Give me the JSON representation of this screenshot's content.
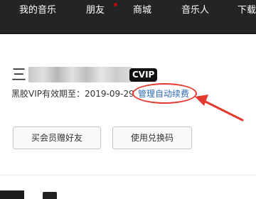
{
  "nav": {
    "items": [
      "我的音乐",
      "朋友",
      "商城",
      "音乐人",
      "下载"
    ],
    "has_notification_on_friends": true
  },
  "profile": {
    "username_visible_prefix": "三",
    "username_obscured": true,
    "vip_badge": "CVIP",
    "vip_info": "黑胶VIP有效期至：2019-09-29",
    "manage_link": "管理自动续费"
  },
  "actions": {
    "gift_label": "买会员赠好友",
    "redeem_label": "使用兑换码"
  },
  "colors": {
    "nav_bg": "#242424",
    "link": "#2e6bb7",
    "annotation": "#e53a2f",
    "notification": "#c20c0c"
  }
}
